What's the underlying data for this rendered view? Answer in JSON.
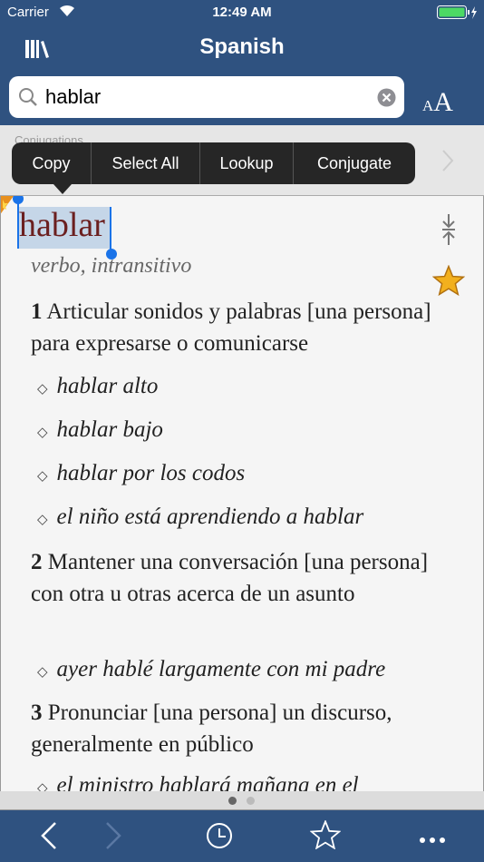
{
  "status": {
    "carrier": "Carrier",
    "time": "12:49 AM"
  },
  "header": {
    "title": "Spanish",
    "font_size_label_small": "A",
    "font_size_label_large": "A"
  },
  "search": {
    "value": "hablar"
  },
  "band": {
    "label": "Conjugations"
  },
  "context_menu": [
    "Copy",
    "Select All",
    "Lookup",
    "Conjugate"
  ],
  "entry": {
    "headword": "hablar",
    "pos": "verbo, intransitivo",
    "senses": [
      {
        "num": "1",
        "text": "Articular sonidos y palabras [una persona] para expresarse o comunicarse",
        "examples": [
          "hablar alto",
          "hablar bajo",
          "hablar por los codos",
          "el niño está aprendiendo a hablar"
        ]
      },
      {
        "num": "2",
        "text": "Mantener una conversación [una persona] con otra u otras acerca de un asunto",
        "examples": [
          "ayer hablé largamente con mi padre"
        ]
      },
      {
        "num": "3",
        "text": "Pronunciar [una persona] un discurso, generalmente en público",
        "examples": [
          "el ministro hablará mañana en el"
        ]
      }
    ]
  },
  "pager": {
    "pages": 2,
    "current": 1
  },
  "colors": {
    "bar": "#2f5280",
    "headword": "#6b1f1f",
    "selection": "#c5d6e8",
    "handle": "#1a73e8",
    "star": "#f2b01e"
  }
}
